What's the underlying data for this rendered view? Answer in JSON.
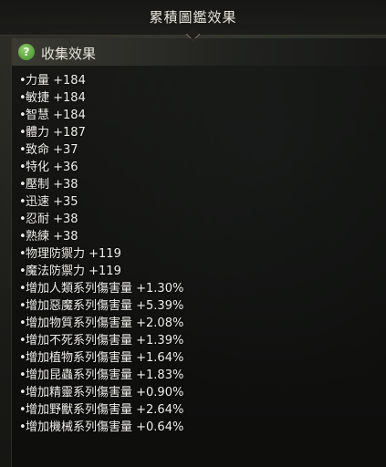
{
  "window": {
    "title": "累積圖鑑效果"
  },
  "section": {
    "icon": "help-icon",
    "icon_glyph": "?",
    "title": "收集效果"
  },
  "bullet": "•",
  "stats": [
    {
      "label": "力量 +184"
    },
    {
      "label": "敏捷 +184"
    },
    {
      "label": "智慧 +184"
    },
    {
      "label": "體力 +187"
    },
    {
      "label": "致命 +37"
    },
    {
      "label": "特化 +36"
    },
    {
      "label": "壓制 +38"
    },
    {
      "label": "迅速 +35"
    },
    {
      "label": "忍耐 +38"
    },
    {
      "label": "熟練 +38"
    },
    {
      "label": "物理防禦力 +119"
    },
    {
      "label": "魔法防禦力 +119"
    },
    {
      "label": "增加人類系列傷害量 +1.30%"
    },
    {
      "label": "增加惡魔系列傷害量 +5.39%"
    },
    {
      "label": "增加物質系列傷害量 +2.08%"
    },
    {
      "label": "增加不死系列傷害量 +1.39%"
    },
    {
      "label": "增加植物系列傷害量 +1.64%"
    },
    {
      "label": "增加昆蟲系列傷害量 +1.83%"
    },
    {
      "label": "增加精靈系列傷害量 +0.90%"
    },
    {
      "label": "增加野獸系列傷害量 +2.64%"
    },
    {
      "label": "增加機械系列傷害量 +0.64%"
    }
  ]
}
